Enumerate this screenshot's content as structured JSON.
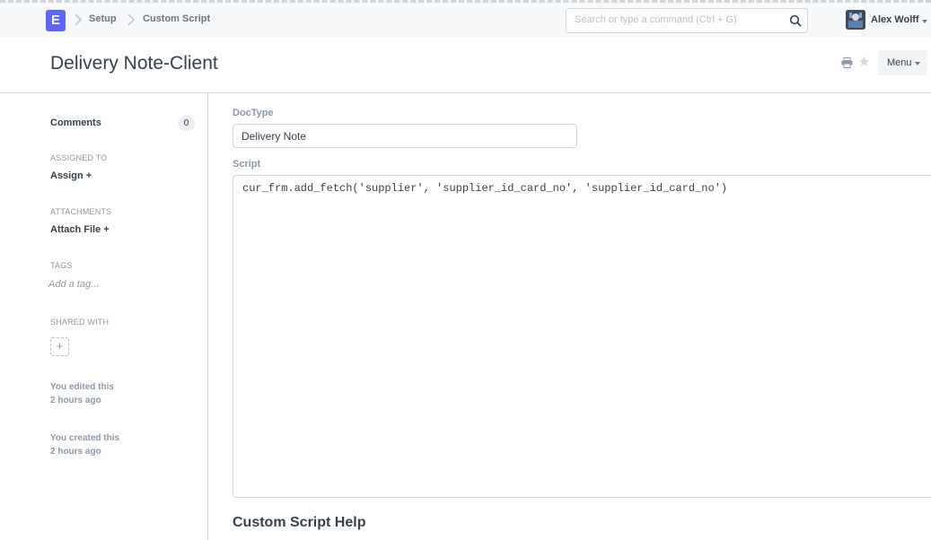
{
  "navbar": {
    "brand_letter": "E",
    "breadcrumbs": [
      "Setup",
      "Custom Script"
    ],
    "search_placeholder": "Search or type a command (Ctrl + G)",
    "user_name": "Alex Wolff"
  },
  "page": {
    "title": "Delivery Note-Client",
    "menu_label": "Menu"
  },
  "sidebar": {
    "comments_label": "Comments",
    "comments_count": "0",
    "assigned_heading": "ASSIGNED TO",
    "assign_link": "Assign +",
    "attachments_heading": "ATTACHMENTS",
    "attach_link": "Attach File +",
    "tags_heading": "TAGS",
    "tag_placeholder": "Add a tag...",
    "shared_heading": "SHARED WITH",
    "share_add": "+",
    "edited_text": "You edited this",
    "edited_time": "2 hours ago",
    "created_text": "You created this",
    "created_time": "2 hours ago"
  },
  "form": {
    "doctype_label": "DocType",
    "doctype_value": "Delivery Note",
    "script_label": "Script",
    "script_value": "cur_frm.add_fetch('supplier', 'supplier_id_card_no', 'supplier_id_card_no')",
    "help_title": "Custom Script Help"
  },
  "colors": {
    "brand": "#5e64ff",
    "muted_text": "#8d99a6",
    "border": "#d1d8dd"
  }
}
